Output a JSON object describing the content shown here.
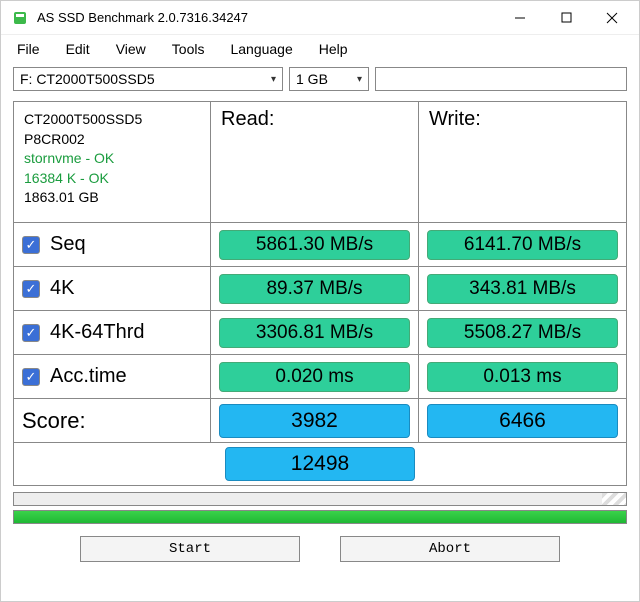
{
  "window": {
    "title": "AS SSD Benchmark 2.0.7316.34247"
  },
  "menu": {
    "file": "File",
    "edit": "Edit",
    "view": "View",
    "tools": "Tools",
    "language": "Language",
    "help": "Help"
  },
  "toolbar": {
    "drive": "F: CT2000T500SSD5",
    "size": "1 GB"
  },
  "info": {
    "model": "CT2000T500SSD5",
    "firmware": "P8CR002",
    "driver_status": "stornvme - OK",
    "align_status": "16384 K - OK",
    "capacity": "1863.01 GB"
  },
  "headers": {
    "read": "Read:",
    "write": "Write:"
  },
  "rows": {
    "seq": {
      "label": "Seq",
      "read": "5861.30 MB/s",
      "write": "6141.70 MB/s"
    },
    "k4": {
      "label": "4K",
      "read": "89.37 MB/s",
      "write": "343.81 MB/s"
    },
    "k464": {
      "label": "4K-64Thrd",
      "read": "3306.81 MB/s",
      "write": "5508.27 MB/s"
    },
    "acc": {
      "label": "Acc.time",
      "read": "0.020 ms",
      "write": "0.013 ms"
    }
  },
  "score": {
    "label": "Score:",
    "read": "3982",
    "write": "6466",
    "total": "12498"
  },
  "buttons": {
    "start": "Start",
    "abort": "Abort"
  }
}
